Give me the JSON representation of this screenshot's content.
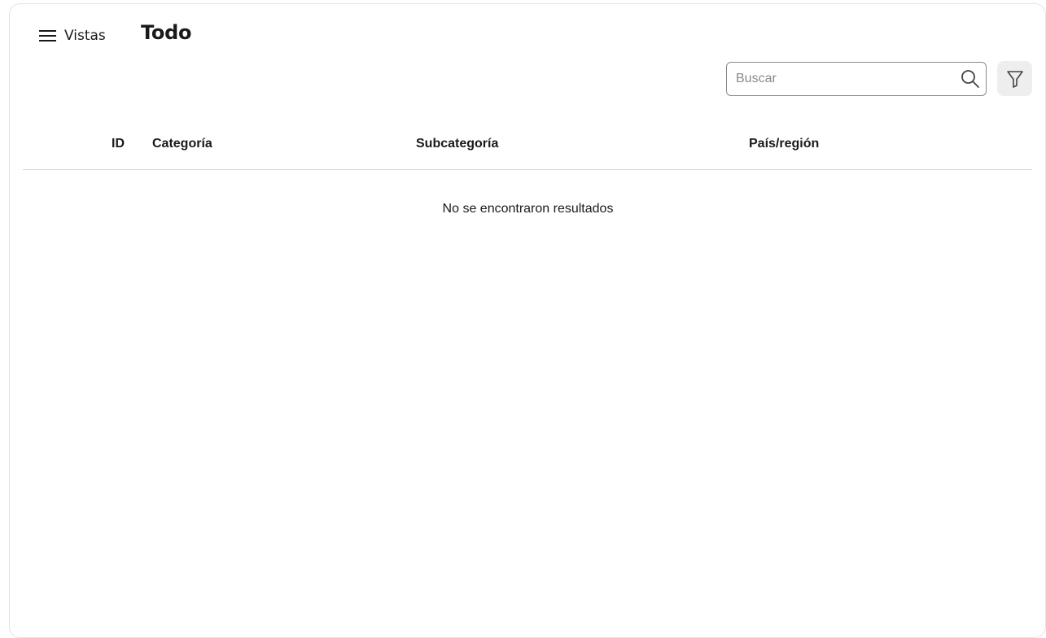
{
  "header": {
    "views_label": "Vistas",
    "page_title": "Todo"
  },
  "search": {
    "placeholder": "Buscar",
    "value": ""
  },
  "icons": {
    "menu": "hamburger-menu-icon",
    "search": "magnifier-icon",
    "filter": "funnel-icon"
  },
  "table": {
    "columns": [
      "ID",
      "Categoría",
      "Subcategoría",
      "País/región"
    ],
    "rows": [],
    "empty_message": "No se encontraron resultados"
  },
  "colors": {
    "text": "#1a1a1a",
    "border": "#e3e3e3",
    "filter_bg": "#eeeeee",
    "placeholder": "#8a8a8a"
  }
}
